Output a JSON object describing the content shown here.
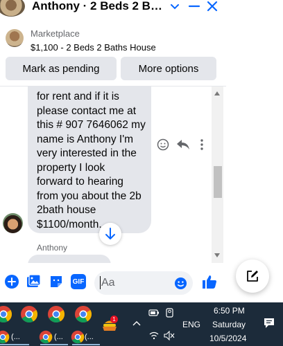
{
  "header": {
    "title": "Anthony · 2 Beds 2 Baths ..."
  },
  "marketplace": {
    "label": "Marketplace",
    "listing": "$1,100 - 2 Beds 2 Baths House",
    "pending_button": "Mark as pending",
    "more_button": "More options"
  },
  "message": {
    "text": "for rent and if it is\nplease contact me at\nthis # 907 7646062 my\nname is Anthony  I'm\nvery interested in the\nproperty I look\nforward to hearing\nfrom you about the 2b\n2bath  house\n$1100/month.",
    "sender": "Anthony"
  },
  "composer": {
    "placeholder": "Aa",
    "gif_label": "GIF"
  },
  "taskbar": {
    "app_label": "(...",
    "time": "6:50 PM",
    "day": "Saturday",
    "date": "10/5/2024",
    "language": "ENG",
    "notification_count": "1"
  },
  "colors": {
    "accent": "#0866ff",
    "bubble": "#e4e6eb",
    "taskbar": "#1c2b3a"
  }
}
